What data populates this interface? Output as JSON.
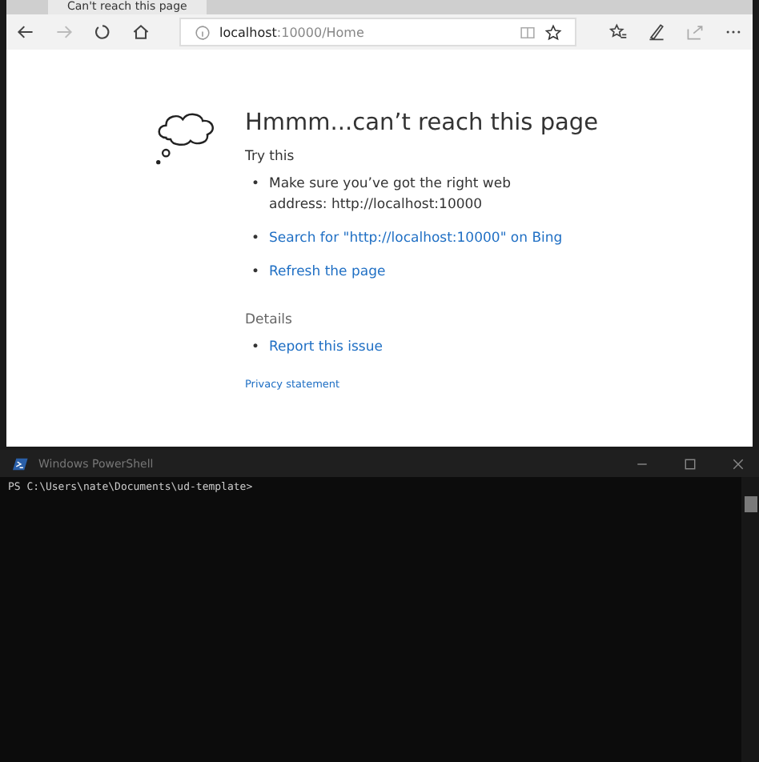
{
  "browser": {
    "tab": {
      "title": "Can't reach this page"
    },
    "address_bar": {
      "host": "localhost",
      "path": ":10000/Home"
    }
  },
  "error_page": {
    "title": "Hmmm...can’t reach this page",
    "subtitle": "Try this",
    "suggestions": [
      {
        "kind": "text",
        "bullet": "•",
        "text": "Make sure you’ve got the right web address: http://localhost:10000"
      },
      {
        "kind": "link",
        "bullet": "•",
        "text": "Search for \"http://localhost:10000\" on Bing"
      },
      {
        "kind": "link",
        "bullet": "•",
        "text": "Refresh the page"
      }
    ],
    "details_heading": "Details",
    "details": [
      {
        "kind": "link",
        "bullet": "•",
        "text": "Report this issue"
      }
    ],
    "footer_link": "Privacy statement"
  },
  "terminal": {
    "title": "Windows PowerShell",
    "prompt": "PS C:\\Users\\nate\\Documents\\ud-template>"
  }
}
